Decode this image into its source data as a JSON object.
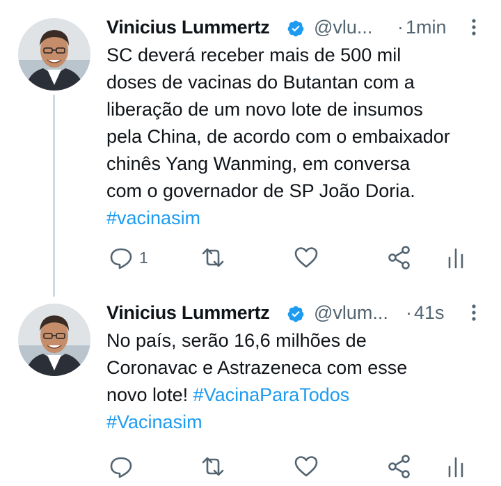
{
  "colors": {
    "link": "#1d9bf0",
    "muted": "#536471",
    "text": "#0f1419",
    "verified": "#1d9bf0",
    "thread_line": "#cfd9de"
  },
  "tweets": [
    {
      "author": "Vinicius Lummertz",
      "handle": "@vlu...",
      "separator": "·",
      "time": "1min",
      "lines": [
        "SC deverá receber mais de 500 mil",
        "doses de vacinas do Butantan com a",
        "liberação de um novo lote de insumos",
        "pela China, de acordo com o embaixador",
        "chinês Yang Wanming, em conversa",
        "com o governador de SP João Doria."
      ],
      "hashtags_line": "#vacinasim",
      "reply_count": "1",
      "icons": [
        "reply-icon",
        "retweet-icon",
        "like-icon",
        "share-icon",
        "analytics-icon"
      ]
    },
    {
      "author": "Vinicius Lummertz",
      "handle": "@vlum...",
      "separator": "·",
      "time": "41s",
      "lines": [
        "No país, serão 16,6 milhões de",
        "Coronavac e Astrazeneca com esse"
      ],
      "line3_text": "novo lote! ",
      "line3_hashtag": "#VacinaParaTodos",
      "hashtags_line": "#Vacinasim",
      "icons": [
        "reply-icon",
        "retweet-icon",
        "like-icon",
        "share-icon",
        "analytics-icon"
      ]
    }
  ]
}
